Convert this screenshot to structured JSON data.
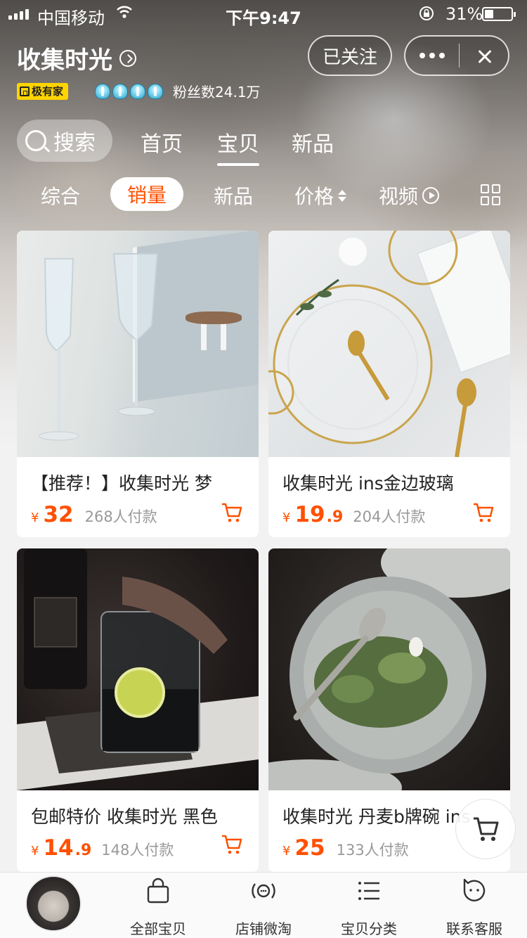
{
  "status_bar": {
    "carrier": "中国移动",
    "time": "下午9:47",
    "battery": "31%"
  },
  "store": {
    "name": "收集时光",
    "follow_label": "已关注",
    "badge": "极有家",
    "fans": "粉丝数24.1万"
  },
  "nav_tabs": {
    "search": "搜索",
    "items": [
      "首页",
      "宝贝",
      "新品"
    ],
    "active": "宝贝"
  },
  "sort_bar": {
    "items": [
      "综合",
      "销量",
      "新品",
      "价格",
      "视频"
    ],
    "active": "销量"
  },
  "products": [
    {
      "title": "【推荐！】收集时光 梦",
      "yen": "¥",
      "price_int": "32",
      "price_dec": "",
      "sold": "268人付款"
    },
    {
      "title": "收集时光 ins金边玻璃",
      "yen": "¥",
      "price_int": "19",
      "price_dec": ".9",
      "sold": "204人付款"
    },
    {
      "title": "包邮特价 收集时光 黑色",
      "yen": "¥",
      "price_int": "14",
      "price_dec": ".9",
      "sold": "148人付款"
    },
    {
      "title": "收集时光 丹麦b牌碗 ins",
      "yen": "¥",
      "price_int": "25",
      "price_dec": "",
      "sold": "133人付款"
    }
  ],
  "bottom_tabs": [
    "全部宝贝",
    "店铺微淘",
    "宝贝分类",
    "联系客服"
  ],
  "colors": {
    "accent": "#ff5000",
    "badge_yellow": "#ffd400"
  },
  "icons": [
    "wifi-icon",
    "lock-rotation-icon",
    "chevron-right-icon",
    "search-icon",
    "sort-updown-icon",
    "play-icon",
    "grid-view-icon",
    "cart-icon",
    "bag-icon",
    "broadcast-icon",
    "list-icon",
    "service-icon"
  ]
}
